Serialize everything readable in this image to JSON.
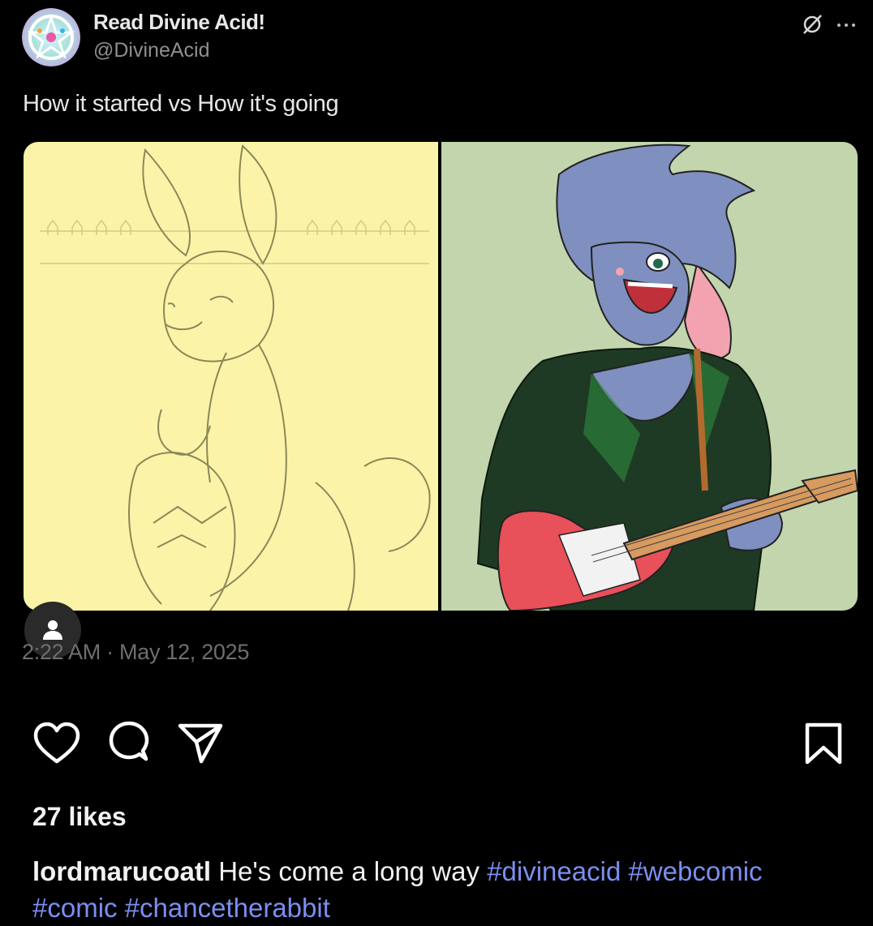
{
  "post": {
    "display_name": "Read Divine Acid!",
    "handle": "@DivineAcid",
    "text": "How it started vs How it's going",
    "timestamp": "2:22 AM · May 12, 2025"
  },
  "icons": {
    "top_right": [
      "mute-icon",
      "more-options-icon"
    ],
    "actions": [
      "heart-icon",
      "comment-icon",
      "share-icon"
    ],
    "save": "bookmark-icon",
    "user_tag": "user-icon"
  },
  "engagement": {
    "likes": "27 likes"
  },
  "caption": {
    "username": "lordmarucoatl",
    "text": "He's come a long way",
    "hashtags": [
      "#divineacid",
      "#webcomic",
      "#comic",
      "#chancetherabbit"
    ]
  },
  "colors": {
    "background": "#000000",
    "hashtag": "#7b8ff0",
    "handle": "#8f8f8f",
    "sketch_bg": "#fbf4a8",
    "art_bg": "#c3d5ad"
  }
}
